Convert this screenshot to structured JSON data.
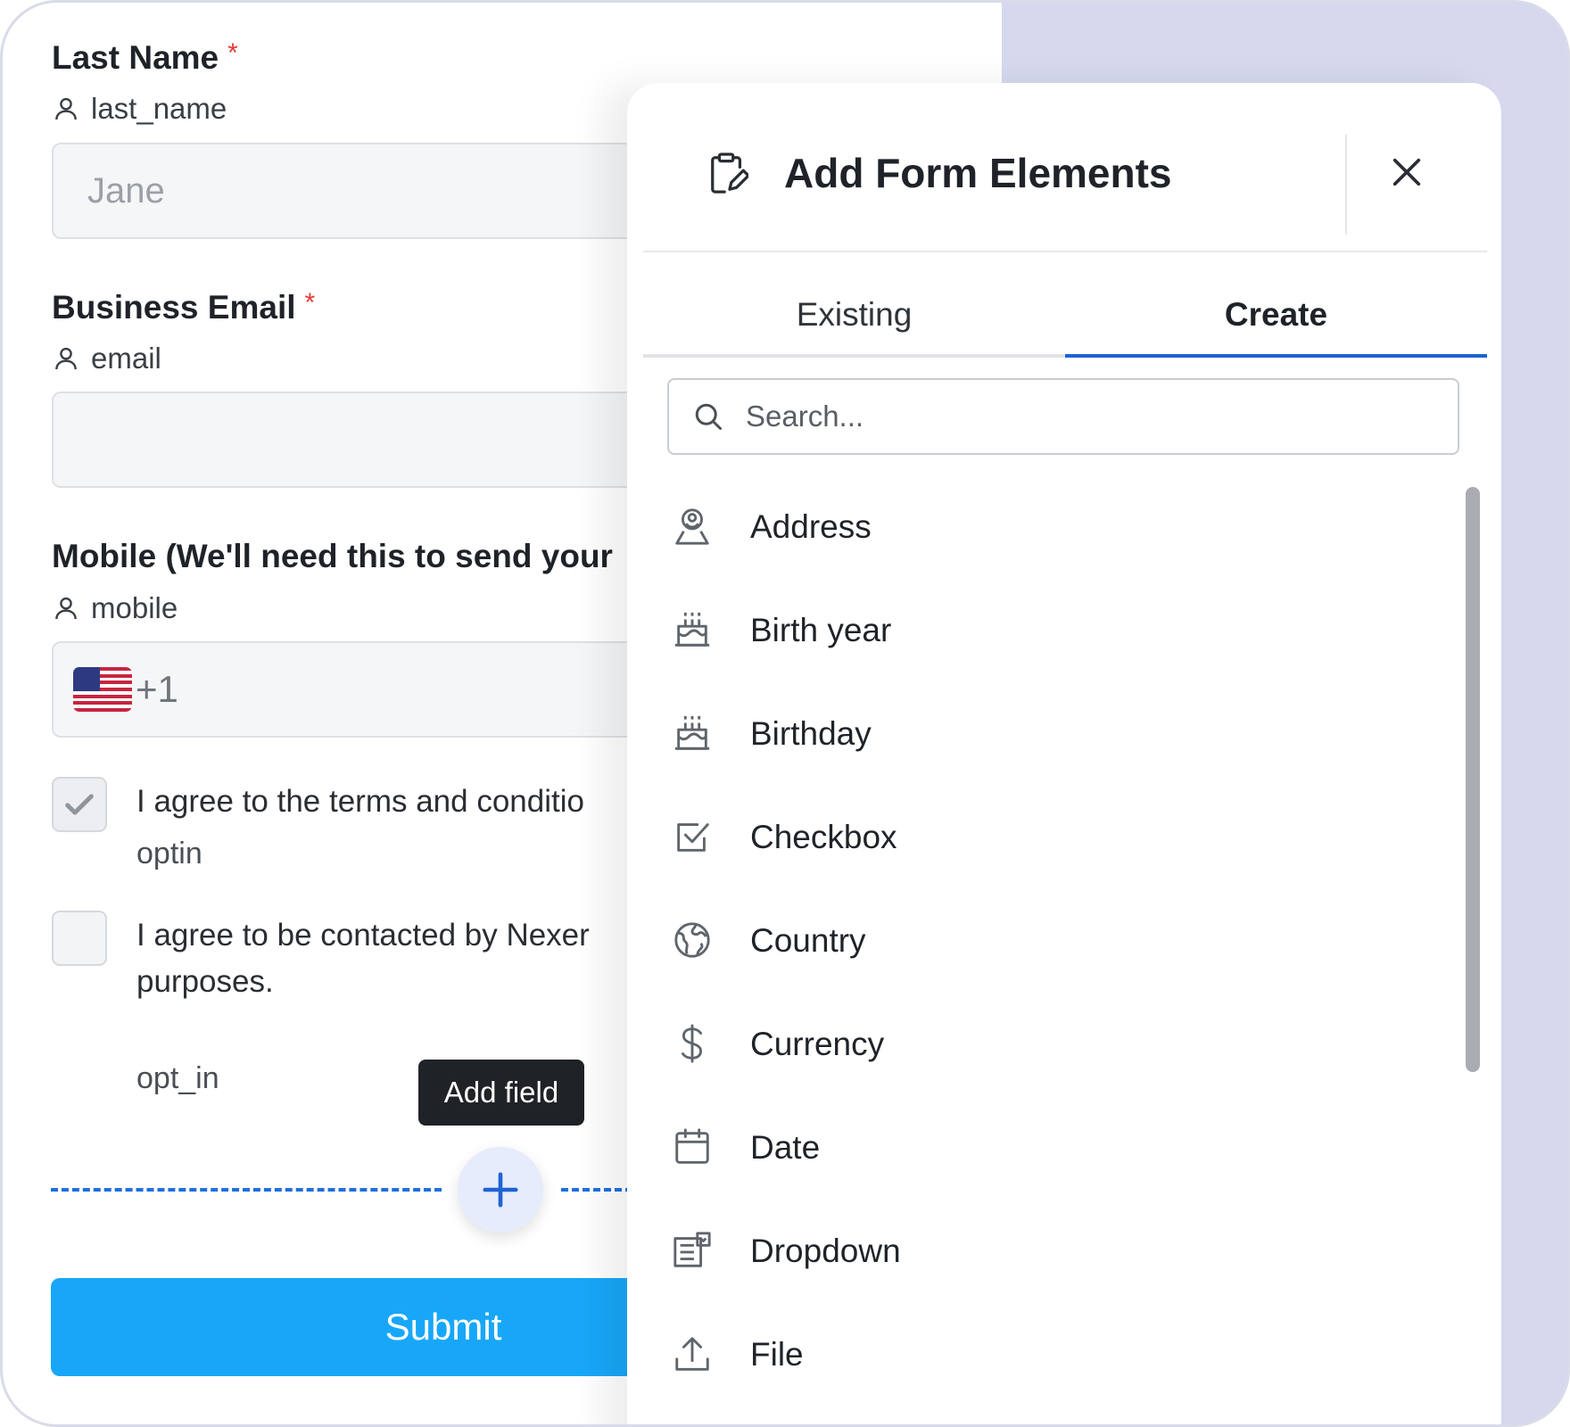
{
  "form": {
    "last_name": {
      "label": "Last Name",
      "required_mark": "*",
      "key": "last_name",
      "placeholder": "Jane"
    },
    "business_email": {
      "label": "Business Email",
      "required_mark": "*",
      "key": "email",
      "placeholder": ""
    },
    "mobile": {
      "label": "Mobile (We'll need this to send your",
      "key": "mobile",
      "dial_code": "+1"
    },
    "optin": {
      "label": "I agree to the terms and conditio",
      "key": "optin",
      "checked": true
    },
    "opt_in": {
      "label_line1": "I agree to be contacted by Nexer",
      "label_line2": "purposes.",
      "key": "opt_in",
      "checked": false
    },
    "add_field_tooltip": "Add field",
    "submit_label": "Submit"
  },
  "panel": {
    "title": "Add Form Elements",
    "tabs": [
      {
        "label": "Existing",
        "active": false
      },
      {
        "label": "Create",
        "active": true
      }
    ],
    "search_placeholder": "Search...",
    "items": [
      {
        "label": "Address",
        "icon": "address-icon"
      },
      {
        "label": "Birth year",
        "icon": "cake-icon"
      },
      {
        "label": "Birthday",
        "icon": "cake-icon"
      },
      {
        "label": "Checkbox",
        "icon": "checkbox-icon"
      },
      {
        "label": "Country",
        "icon": "globe-icon"
      },
      {
        "label": "Currency",
        "icon": "dollar-icon"
      },
      {
        "label": "Date",
        "icon": "calendar-icon"
      },
      {
        "label": "Dropdown",
        "icon": "dropdown-icon"
      },
      {
        "label": "File",
        "icon": "upload-icon"
      }
    ]
  },
  "colors": {
    "accent": "#1e63d4",
    "submit": "#18a7f8",
    "required": "#e53935",
    "frame_bg": "#d6d9ee"
  }
}
